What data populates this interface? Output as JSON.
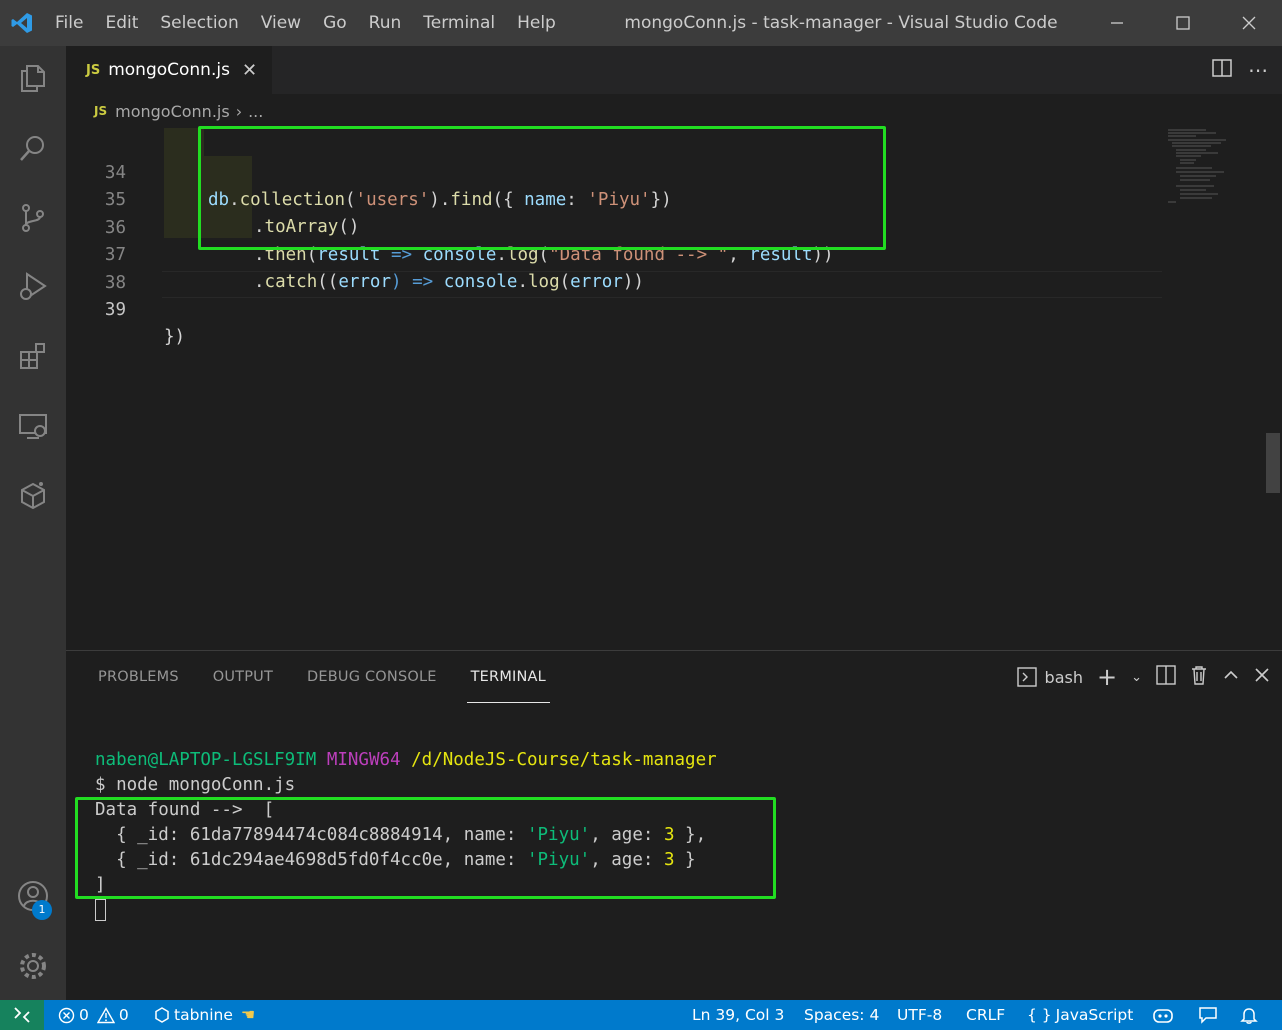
{
  "window": {
    "title": "mongoConn.js - task-manager - Visual Studio Code",
    "menu": [
      "File",
      "Edit",
      "Selection",
      "View",
      "Go",
      "Run",
      "Terminal",
      "Help"
    ]
  },
  "tab": {
    "badge": "JS",
    "label": "mongoConn.js"
  },
  "breadcrumb": {
    "badge": "JS",
    "file": "mongoConn.js",
    "more": "..."
  },
  "editor": {
    "line_numbers": [
      "34",
      "35",
      "36",
      "37",
      "38",
      "39"
    ],
    "active_line": "39",
    "lines": {
      "l34": {
        "a": "db",
        "b": ".",
        "c": "collection",
        "d": "(",
        "e": "'users'",
        "f": ").",
        "g": "find",
        "h": "({ ",
        "i": "name",
        "j": ": ",
        "k": "'Piyu'",
        "l": "})"
      },
      "l35": {
        "a": ".",
        "b": "toArray",
        "c": "()"
      },
      "l36": {
        "a": ".",
        "b": "then",
        "c": "(",
        "d": "result",
        "e": " => ",
        "f": "console",
        "g": ".",
        "h": "log",
        "i": "(",
        "j": "\"Data found --> \"",
        "k": ", ",
        "l": "result",
        "m": "))"
      },
      "l37": {
        "a": ".",
        "b": "catch",
        "c": "((",
        "d": "error",
        "e": ") => ",
        "f": "console",
        "g": ".",
        "h": "log",
        "i": "(",
        "j": "error",
        "k": "))"
      },
      "l39": {
        "a": "})"
      }
    }
  },
  "panel": {
    "tabs": [
      "PROBLEMS",
      "OUTPUT",
      "DEBUG CONSOLE",
      "TERMINAL"
    ],
    "active_tab": "TERMINAL",
    "shell": "bash",
    "terminal": {
      "prompt_user": "naben@LAPTOP-LGSLF9IM",
      "prompt_env": "MINGW64",
      "prompt_path": "/d/NodeJS-Course/task-manager",
      "command": "$ node mongoConn.js",
      "out1": "Data found -->  [",
      "row1": {
        "pre": "  { _id: 61da77894474c084c8884914, name: ",
        "name": "'Piyu'",
        "mid": ", age: ",
        "age": "3",
        "post": " },"
      },
      "row2": {
        "pre": "  { _id: 61dc294ae4698d5fd0f4cc0e, name: ",
        "name": "'Piyu'",
        "mid": ", age: ",
        "age": "3",
        "post": " }"
      },
      "close": "]"
    }
  },
  "activity": {
    "account_badge": "1"
  },
  "statusbar": {
    "errors": "0",
    "warnings": "0",
    "tabnine": "tabnine",
    "position": "Ln 39, Col 3",
    "spaces": "Spaces: 4",
    "encoding": "UTF-8",
    "eol": "CRLF",
    "language": "JavaScript"
  },
  "colors": {
    "accent": "#007acc",
    "highlight_box": "#22dd22",
    "remote": "#16825d"
  }
}
